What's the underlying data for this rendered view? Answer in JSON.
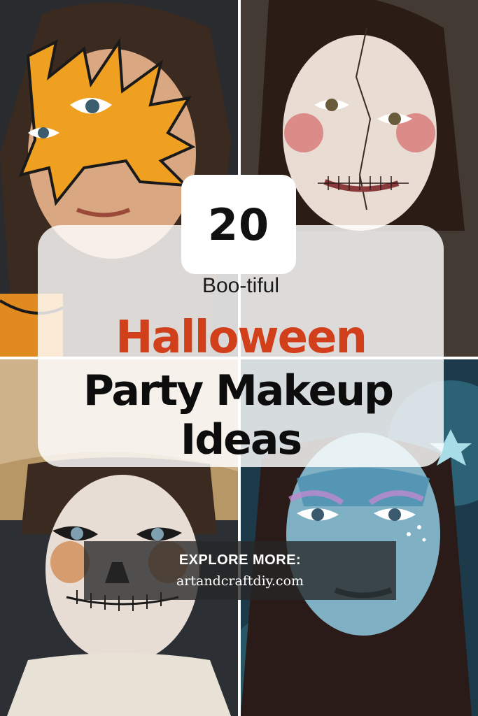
{
  "count": "20",
  "subtitle": "Boo-tiful",
  "title_line_1": "Halloween",
  "title_line_2": "Party Makeup",
  "title_line_3": "Ideas",
  "explore": {
    "label": "EXPLORE MORE:",
    "url": "artandcraftdiy.com"
  },
  "colors": {
    "accent": "#d2401b",
    "text": "#0d0d0d"
  }
}
